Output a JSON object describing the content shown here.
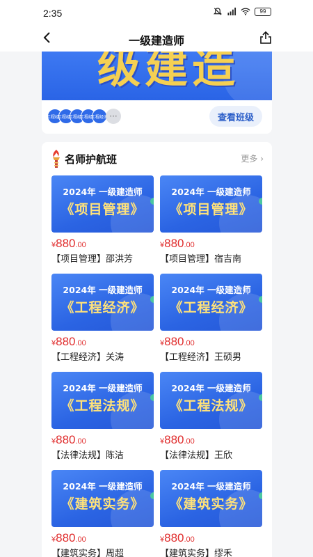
{
  "status": {
    "time": "2:35",
    "battery": "99"
  },
  "nav": {
    "title": "一级建造师"
  },
  "banner": {
    "deco_text": "级建造师",
    "view_class_label": "查看班级",
    "avatar_text": "工程经济",
    "more_symbol": "···"
  },
  "section": {
    "title": "名师护航班",
    "more": "更多 ›",
    "courses": [
      {
        "line1": "2024年  一级建造师",
        "line2": "《项目管理》",
        "currency": "¥",
        "price_int": "880",
        "price_dec": ".00",
        "title": "【项目管理】邵洪芳"
      },
      {
        "line1": "2024年  一级建造师",
        "line2": "《项目管理》",
        "currency": "¥",
        "price_int": "880",
        "price_dec": ".00",
        "title": "【项目管理】宿吉南"
      },
      {
        "line1": "2024年  一级建造师",
        "line2": "《工程经济》",
        "currency": "¥",
        "price_int": "880",
        "price_dec": ".00",
        "title": "【工程经济】关涛"
      },
      {
        "line1": "2024年  一级建造师",
        "line2": "《工程经济》",
        "currency": "¥",
        "price_int": "880",
        "price_dec": ".00",
        "title": "【工程经济】王硕男"
      },
      {
        "line1": "2024年  一级建造师",
        "line2": "《工程法规》",
        "currency": "¥",
        "price_int": "880",
        "price_dec": ".00",
        "title": "【法律法规】陈洁"
      },
      {
        "line1": "2024年  一级建造师",
        "line2": "《工程法规》",
        "currency": "¥",
        "price_int": "880",
        "price_dec": ".00",
        "title": "【法律法规】王欣"
      },
      {
        "line1": "2024年  一级建造师",
        "line2": "《建筑实务》",
        "currency": "¥",
        "price_int": "880",
        "price_dec": ".00",
        "title": "【建筑实务】周超"
      },
      {
        "line1": "2024年  一级建造师",
        "line2": "《建筑实务》",
        "currency": "¥",
        "price_int": "880",
        "price_dec": ".00",
        "title": "【建筑实务】缪禾"
      }
    ]
  },
  "colors": {
    "accent": "#2c64e6",
    "price": "#e02d2d",
    "highlight": "#ffe27a"
  }
}
